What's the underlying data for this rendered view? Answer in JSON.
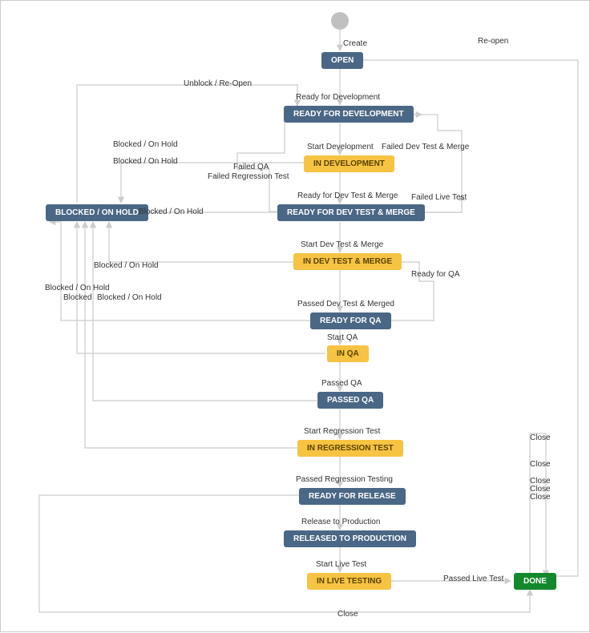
{
  "nodes": {
    "open": {
      "label": "OPEN"
    },
    "ready_dev": {
      "label": "READY FOR DEVELOPMENT"
    },
    "in_dev": {
      "label": "IN DEVELOPMENT"
    },
    "ready_dev_test": {
      "label": "READY FOR DEV TEST & MERGE"
    },
    "in_dev_test": {
      "label": "IN DEV TEST & MERGE"
    },
    "ready_qa": {
      "label": "READY FOR QA"
    },
    "in_qa": {
      "label": "IN QA"
    },
    "passed_qa": {
      "label": "PASSED QA"
    },
    "in_regression": {
      "label": "IN REGRESSION TEST"
    },
    "ready_release": {
      "label": "READY FOR RELEASE"
    },
    "released": {
      "label": "RELEASED TO PRODUCTION"
    },
    "in_live": {
      "label": "IN LIVE TESTING"
    },
    "blocked": {
      "label": "BLOCKED / ON HOLD"
    },
    "done": {
      "label": "DONE"
    }
  },
  "transitions": {
    "create": "Create",
    "reopen": "Re-open",
    "unblock_reopen": "Unblock / Re-Open",
    "ready_for_development": "Ready for Development",
    "start_development": "Start Development",
    "failed_dev_test_merge": "Failed Dev Test & Merge",
    "failed_qa": "Failed QA",
    "failed_regression": "Failed Regression Test",
    "ready_dev_test_merge": "Ready for Dev Test & Merge",
    "failed_live_test": "Failed Live Test",
    "start_dev_test": "Start Dev Test & Merge",
    "ready_for_qa": "Ready for QA",
    "passed_dev_test": "Passed Dev Test & Merged",
    "start_qa": "Start QA",
    "passed_qa": "Passed QA",
    "start_regression": "Start Regression Test",
    "passed_regression": "Passed Regression Testing",
    "release_prod": "Release to Production",
    "start_live": "Start Live Test",
    "passed_live": "Passed Live Test",
    "close": "Close",
    "blocked_on_hold": "Blocked / On Hold",
    "blocked": "Blocked"
  }
}
